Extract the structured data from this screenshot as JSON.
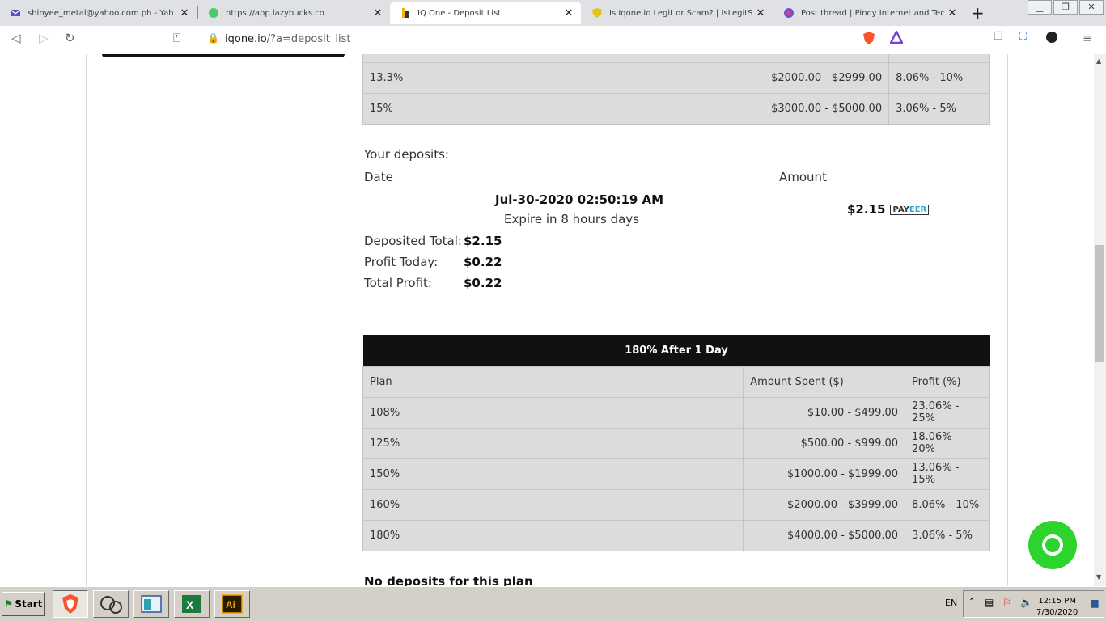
{
  "tabs": [
    {
      "title": "shinyee_metal@yahoo.com.ph - Yah",
      "icon": "mail-icon"
    },
    {
      "title": "https://app.lazybucks.co",
      "icon": "lazybucks-icon"
    },
    {
      "title": "IQ One - Deposit List",
      "icon": "iqone-icon"
    },
    {
      "title": "Is Iqone.io Legit or Scam? | IsLegitS",
      "icon": "islegit-icon"
    },
    {
      "title": "Post thread | Pinoy Internet and Tec",
      "icon": "forum-icon"
    }
  ],
  "address": {
    "domain": "iqone.io",
    "path": "/?a=deposit_list"
  },
  "prev_plan": {
    "rows": [
      {
        "plan": "13.3%",
        "amount": "$2000.00 - $2999.00",
        "profit": "8.06% - 10%"
      },
      {
        "plan": "15%",
        "amount": "$3000.00 - $5000.00",
        "profit": "3.06% - 5%"
      }
    ]
  },
  "deposits": {
    "heading": "Your deposits:",
    "date_col": "Date",
    "amount_col": "Amount",
    "date_value": "Jul-30-2020 02:50:19 AM",
    "expire": "Expire in 8 hours days",
    "amount_value": "$2.15",
    "payeer_a": "PAY",
    "payeer_b": "EER",
    "deposited_label": "Deposited Total:",
    "deposited_value": "$2.15",
    "profit_today_label": "Profit Today:",
    "profit_today_value": "$0.22",
    "total_profit_label": "Total Profit:",
    "total_profit_value": "$0.22"
  },
  "plan2": {
    "title": "180% After 1 Day",
    "headers": [
      "Plan",
      "Amount Spent ($)",
      "Profit (%)"
    ],
    "rows": [
      {
        "plan": "108%",
        "amount": "$10.00 - $499.00",
        "profit": "23.06% - 25%"
      },
      {
        "plan": "125%",
        "amount": "$500.00 - $999.00",
        "profit": "18.06% - 20%"
      },
      {
        "plan": "150%",
        "amount": "$1000.00 - $1999.00",
        "profit": "13.06% - 15%"
      },
      {
        "plan": "160%",
        "amount": "$2000.00 - $3999.00",
        "profit": "8.06% - 10%"
      },
      {
        "plan": "180%",
        "amount": "$4000.00 - $5000.00",
        "profit": "3.06% - 5%"
      }
    ],
    "no_deposits": "No deposits for this plan"
  },
  "taskbar": {
    "start": "Start",
    "lang": "EN",
    "time": "12:15 PM",
    "date": "7/30/2020"
  }
}
